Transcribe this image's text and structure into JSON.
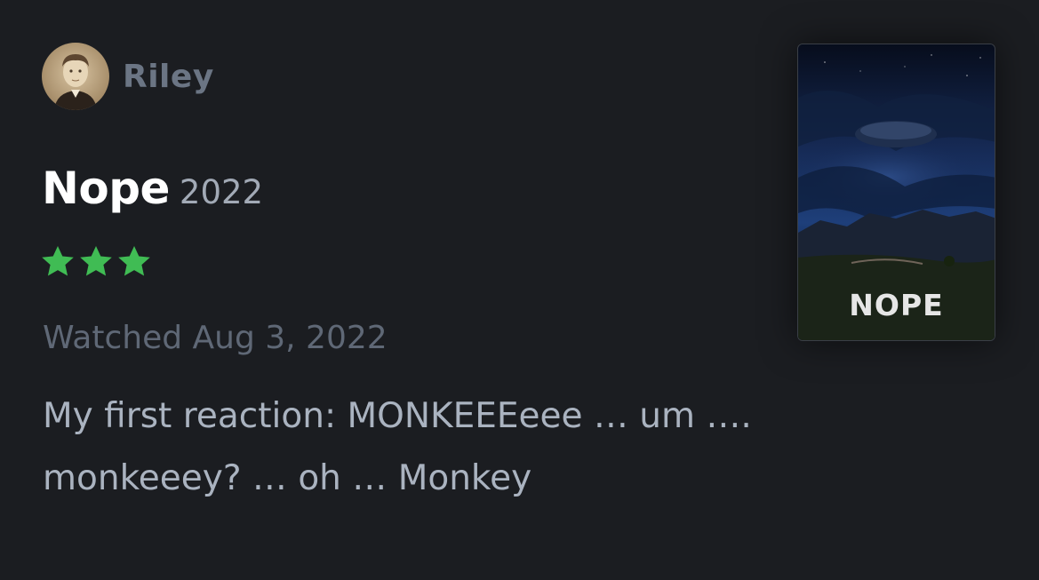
{
  "author": {
    "name": "Riley"
  },
  "film": {
    "title": "Nope",
    "year": "2022",
    "poster_title": "NOPE"
  },
  "rating": {
    "stars": 3,
    "max_shown": 3,
    "color": "#40bc54"
  },
  "watched": "Watched Aug 3, 2022",
  "review": {
    "text": "My first reaction: MONKEEEeee … um …. monkeeey? … oh … Monkey"
  },
  "colors": {
    "background": "#1b1d21",
    "title": "#ffffff",
    "muted": "#5f6876",
    "body": "#aab3c0"
  }
}
